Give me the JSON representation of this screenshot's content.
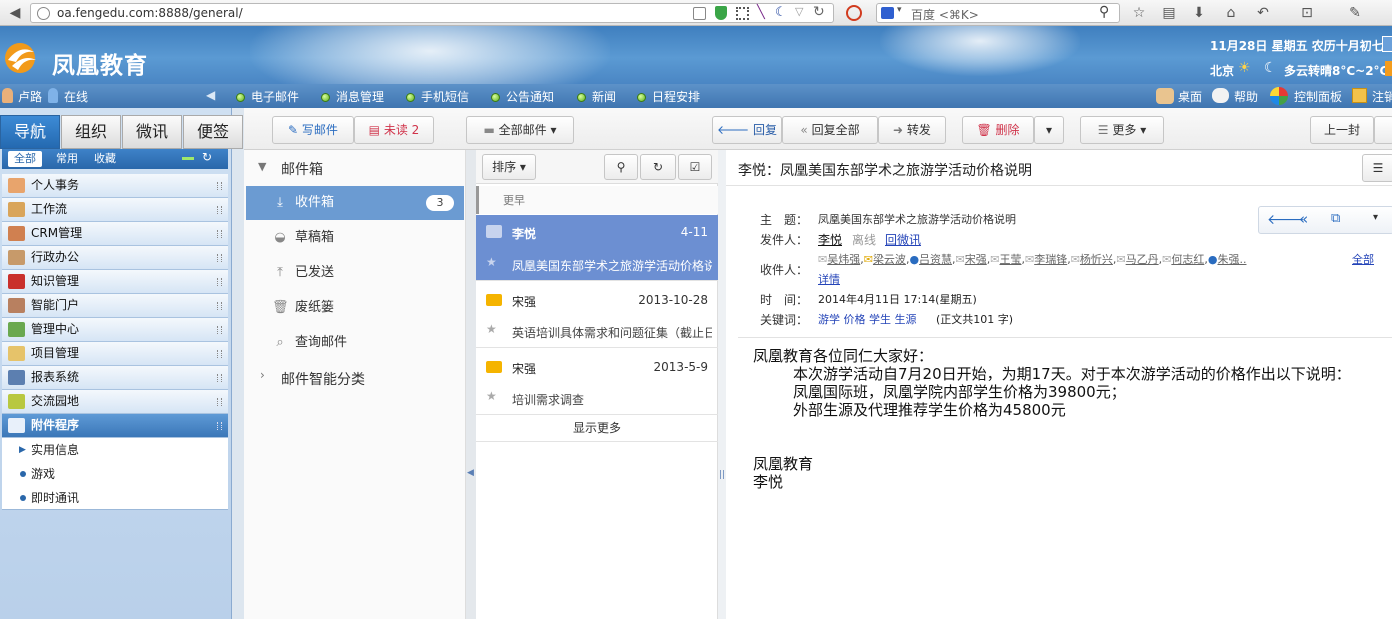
{
  "browser": {
    "url": "oa.fengedu.com:8888/general/",
    "search_placeholder": "百度 <⌘K>"
  },
  "header": {
    "brand": "凤凰教育",
    "date": "11月28日 星期五 农历十月初七",
    "weather": "北京",
    "weather_text": "多云转晴8°C~2°C"
  },
  "strip": {
    "user": "卢路",
    "status": "在线",
    "items": [
      "电子邮件",
      "消息管理",
      "手机短信",
      "公告通知",
      "新闻",
      "日程安排"
    ],
    "right": [
      "桌面",
      "帮助",
      "控制面板",
      "注销"
    ]
  },
  "sidebar": {
    "tabs": [
      "导航",
      "组织",
      "微讯",
      "便签"
    ],
    "subtabs": [
      "全部",
      "常用",
      "收藏"
    ],
    "items": [
      "个人事务",
      "工作流",
      "CRM管理",
      "行政办公",
      "知识管理",
      "智能门户",
      "管理中心",
      "项目管理",
      "报表系统",
      "交流园地",
      "附件程序"
    ],
    "sub_items": [
      "实用信息",
      "游戏",
      "即时通讯"
    ]
  },
  "toolbar": {
    "compose": "写邮件",
    "unread": "未读",
    "unread_count": "2",
    "all_mail": "全部邮件",
    "reply": "回复",
    "reply_all": "回复全部",
    "forward": "转发",
    "delete": "删除",
    "more": "更多",
    "prev": "上一封"
  },
  "folders": {
    "group_title": "邮件箱",
    "items": [
      {
        "label": "收件箱",
        "count": "3"
      },
      {
        "label": "草稿箱"
      },
      {
        "label": "已发送"
      },
      {
        "label": "废纸篓"
      },
      {
        "label": "查询邮件"
      }
    ],
    "smart": "邮件智能分类"
  },
  "list": {
    "sort": "排序",
    "group_label": "更早",
    "mails": [
      {
        "sender": "李悦",
        "date": "4-11",
        "subject": "凤凰美国东部学术之旅游学活动价格说明"
      },
      {
        "sender": "宋强",
        "date": "2013-10-28",
        "subject": "英语培训具体需求和问题征集（截止日"
      },
      {
        "sender": "宋强",
        "date": "2013-5-9",
        "subject": "培训需求调查"
      }
    ],
    "show_more": "显示更多"
  },
  "reader": {
    "title": "李悦：凤凰美国东部学术之旅游学活动价格说明",
    "subject_label": "主　题：",
    "subject": "凤凰美国东部学术之旅游学活动价格说明",
    "from_label": "发件人：",
    "from": "李悦",
    "from_status": "离线",
    "from_action": "回微讯",
    "to_label": "收件人：",
    "recipients": [
      "吴炜强",
      "梁云波",
      "吕资慧",
      "宋强",
      "王莹",
      "李瑞锋",
      "杨忻兴",
      "马乙丹",
      "何志红",
      "朱强.."
    ],
    "to_all": "全部",
    "to_detail": "详情",
    "time_label": "时　间：",
    "time": "2014年4月11日 17:14(星期五)",
    "keywords_label": "关键词：",
    "keywords": "游学 价格 学生 生源",
    "word_count": "(正文共101 字)",
    "body": [
      "凤凰教育各位同仁大家好：",
      "本次游学活动自7月20日开始，为期17天。对于本次游学活动的价格作出以下说明：",
      "凤凰国际班，凤凰学院内部学生价格为39800元；",
      "外部生源及代理推荐学生价格为45800元",
      "凤凰教育",
      "李悦"
    ]
  }
}
